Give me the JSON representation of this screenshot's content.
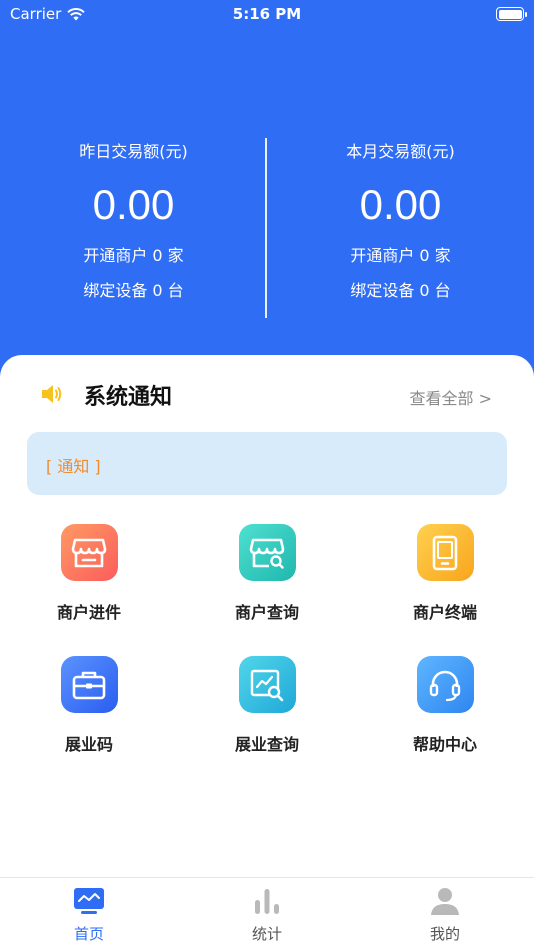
{
  "status_bar": {
    "carrier": "Carrier",
    "time": "5:16 PM"
  },
  "stats": {
    "yesterday": {
      "title": "昨日交易额(元)",
      "amount": "0.00",
      "merchants": "开通商户 0 家",
      "devices": "绑定设备 0 台"
    },
    "month": {
      "title": "本月交易额(元)",
      "amount": "0.00",
      "merchants": "开通商户 0 家",
      "devices": "绑定设备 0 台"
    }
  },
  "notice": {
    "title": "系统通知",
    "view_all": "查看全部 >",
    "tag": "[ 通知 ]"
  },
  "grid": [
    {
      "label": "商户进件",
      "icon": "store-icon",
      "color_from": "#ff9a63",
      "color_to": "#fb5c5c"
    },
    {
      "label": "商户查询",
      "icon": "store-search-icon",
      "color_from": "#4fe0cf",
      "color_to": "#1fb7b0"
    },
    {
      "label": "商户终端",
      "icon": "tablet-icon",
      "color_from": "#ffd14f",
      "color_to": "#f8a51c"
    },
    {
      "label": "展业码",
      "icon": "briefcase-icon",
      "color_from": "#5b93ff",
      "color_to": "#2a5df0"
    },
    {
      "label": "展业查询",
      "icon": "chart-search-icon",
      "color_from": "#52d6ea",
      "color_to": "#1fa8d8"
    },
    {
      "label": "帮助中心",
      "icon": "headset-icon",
      "color_from": "#5fb6ff",
      "color_to": "#2e86f0"
    }
  ],
  "tabs": [
    {
      "label": "首页",
      "icon": "dashboard-icon",
      "active": true
    },
    {
      "label": "统计",
      "icon": "bar-chart-icon",
      "active": false
    },
    {
      "label": "我的",
      "icon": "person-icon",
      "active": false
    }
  ],
  "colors": {
    "primary": "#2f6df5",
    "inactive": "#555555",
    "accent": "#f08c2e"
  }
}
